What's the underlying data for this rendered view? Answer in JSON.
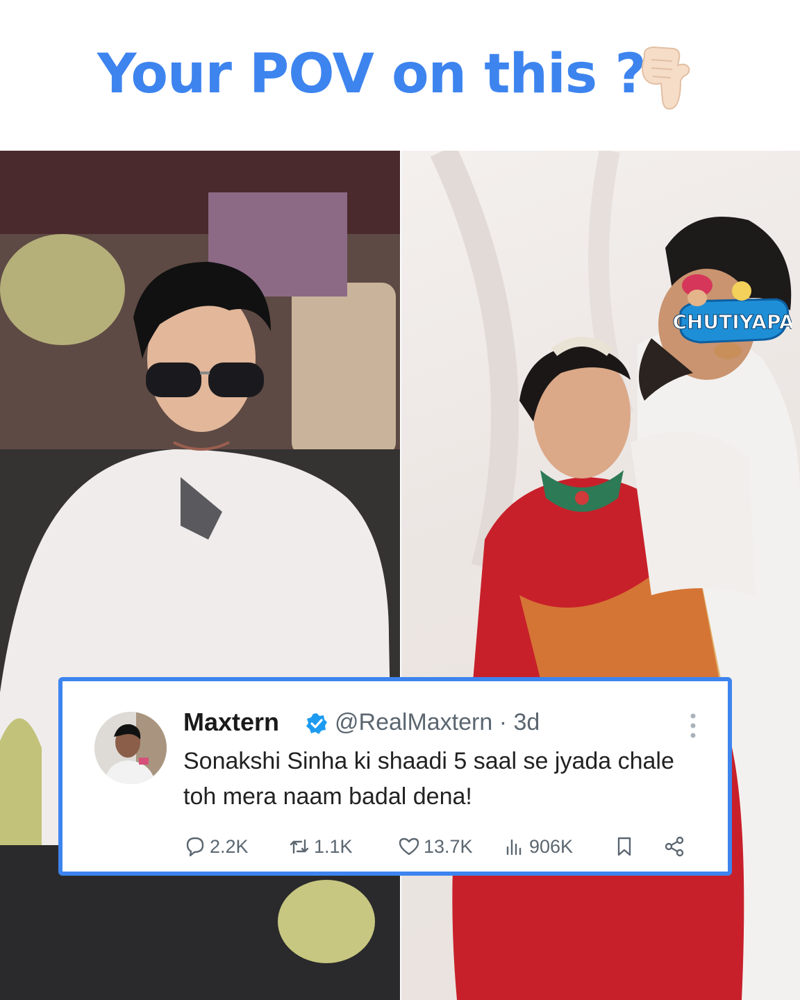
{
  "headline": "Your POV on this ?",
  "icons": {
    "hand": "backhand-index-pointing-down-icon",
    "verified": "verified-badge-icon",
    "more": "more-vertical-icon",
    "reply": "reply-icon",
    "retweet": "retweet-icon",
    "like": "heart-icon",
    "views": "views-icon",
    "bookmark": "bookmark-icon",
    "share": "share-icon"
  },
  "watermark": {
    "text": "CHUTIYAPA"
  },
  "tweet": {
    "name": "Maxtern",
    "handle": "@RealMaxtern",
    "time": "· 3d",
    "text": "Sonakshi Sinha ki shaadi 5 saal se jyada chale toh mera naam badal dena!",
    "replies": "2.2K",
    "retweets": "1.1K",
    "likes": "13.7K",
    "views": "906K"
  },
  "colors": {
    "accent": "#3d84ef",
    "verified": "#1d9bf0",
    "muted": "#5b6670",
    "saree": "#c8202a"
  }
}
